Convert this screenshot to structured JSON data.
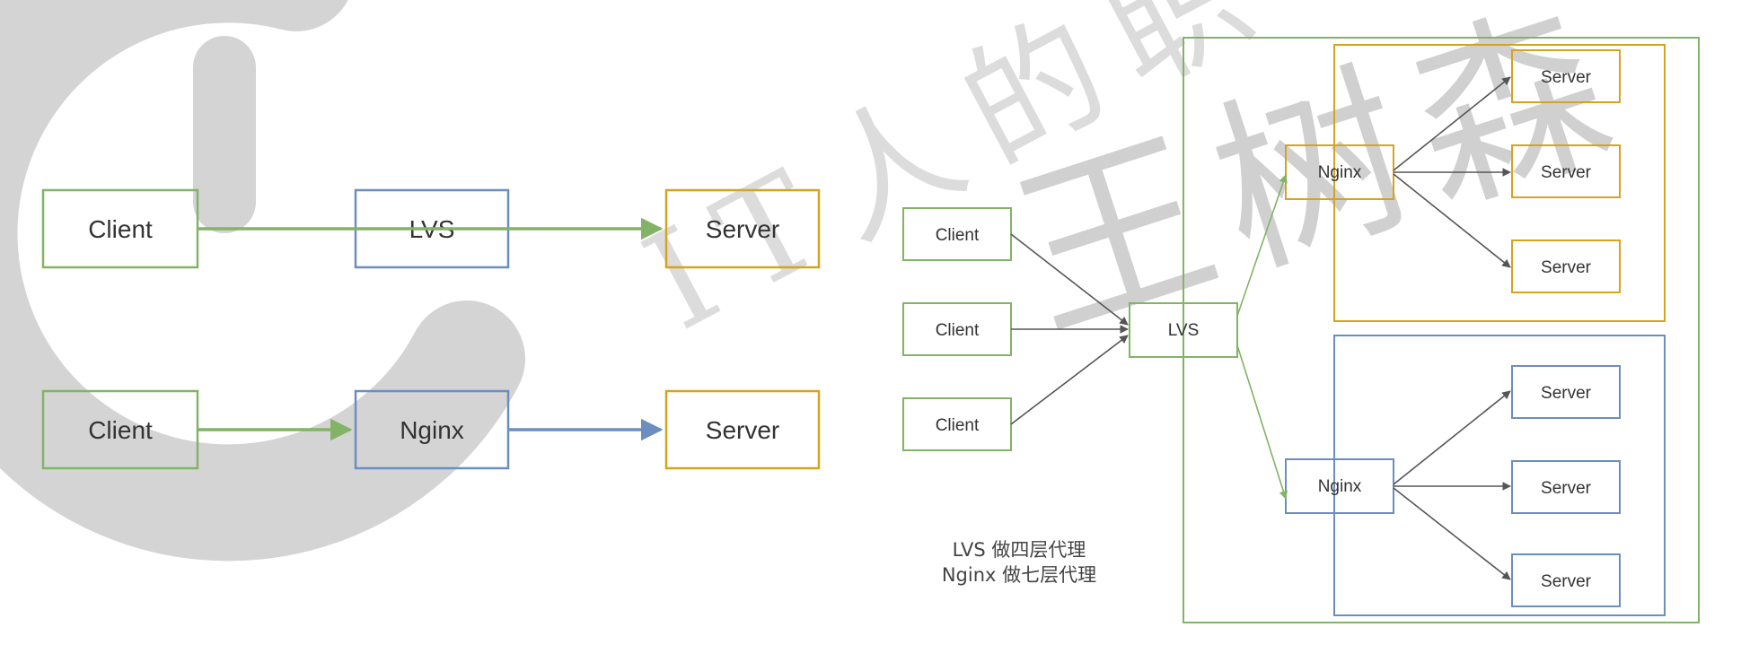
{
  "colors": {
    "green": "#82b366",
    "green_dark": "#5a8f3c",
    "blue": "#6c8ebf",
    "orange": "#d6a31e",
    "arrow_gray": "#555555",
    "watermark": "#cfcfcf"
  },
  "watermark": {
    "text_top": "IT人的职",
    "text_mid": "王树森",
    "logo": "circular-logo-watermark"
  },
  "left_diagram": {
    "lvs_path": {
      "client": "Client",
      "proxy": "LVS",
      "server": "Server"
    },
    "nginx_path": {
      "client": "Client",
      "proxy": "Nginx",
      "server": "Server"
    }
  },
  "right_diagram": {
    "clients": [
      "Client",
      "Client",
      "Client"
    ],
    "lvs": "LVS",
    "upper_group": {
      "nginx": "Nginx",
      "servers": [
        "Server",
        "Server",
        "Server"
      ]
    },
    "lower_group": {
      "nginx": "Nginx",
      "servers": [
        "Server",
        "Server",
        "Server"
      ]
    },
    "caption": {
      "line1": "LVS 做四层代理",
      "line2": "Nginx 做七层代理"
    }
  }
}
